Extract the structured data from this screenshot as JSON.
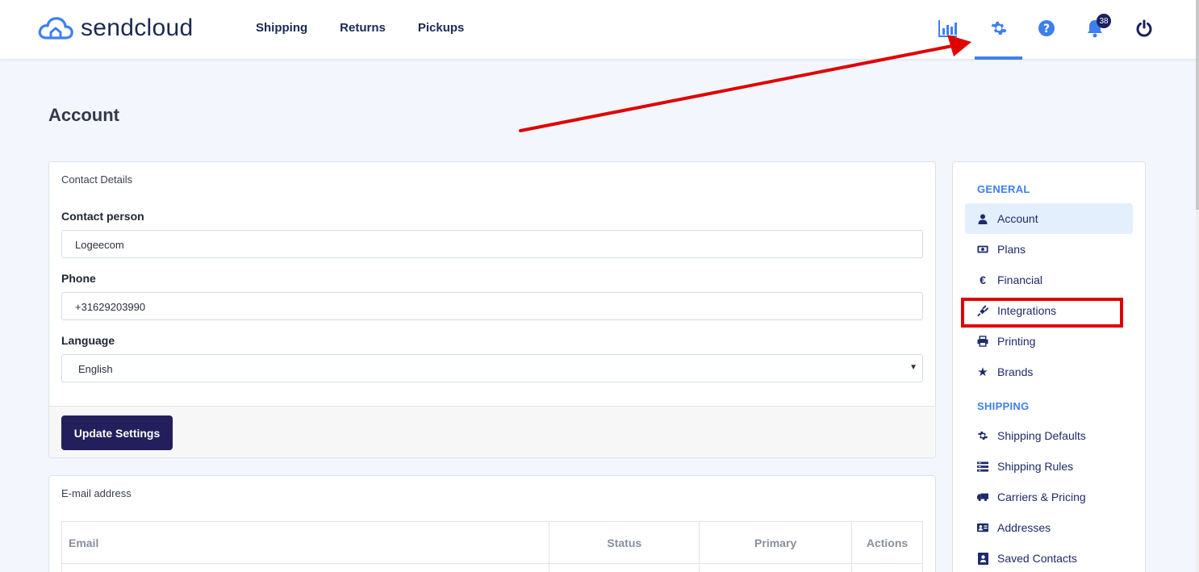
{
  "app": {
    "logo_text": "sendcloud"
  },
  "nav": {
    "items": [
      "Shipping",
      "Returns",
      "Pickups"
    ]
  },
  "header": {
    "notifications_count": "38"
  },
  "page": {
    "title": "Account"
  },
  "contact": {
    "title": "Contact Details",
    "person_label": "Contact person",
    "person_value": "Logeecom",
    "phone_label": "Phone",
    "phone_value": "+31629203990",
    "language_label": "Language",
    "language_value": "English",
    "update_button": "Update Settings"
  },
  "email": {
    "title": "E-mail address",
    "columns": [
      "Email",
      "Status",
      "Primary",
      "Actions"
    ]
  },
  "sidebar": {
    "general_heading": "GENERAL",
    "general_items": [
      {
        "label": "Account",
        "icon": "user-icon"
      },
      {
        "label": "Plans",
        "icon": "money-icon"
      },
      {
        "label": "Financial",
        "icon": "euro-icon"
      },
      {
        "label": "Integrations",
        "icon": "plug-icon"
      },
      {
        "label": "Printing",
        "icon": "printer-icon"
      },
      {
        "label": "Brands",
        "icon": "star-icon"
      }
    ],
    "shipping_heading": "SHIPPING",
    "shipping_items": [
      {
        "label": "Shipping Defaults",
        "icon": "gear-icon"
      },
      {
        "label": "Shipping Rules",
        "icon": "rules-icon"
      },
      {
        "label": "Carriers & Pricing",
        "icon": "truck-icon"
      },
      {
        "label": "Addresses",
        "icon": "address-card-icon"
      },
      {
        "label": "Saved Contacts",
        "icon": "contact-book-icon"
      }
    ]
  },
  "colors": {
    "accent": "#3d7ff0",
    "primary_button": "#221f5c",
    "annotation": "#e00000"
  }
}
